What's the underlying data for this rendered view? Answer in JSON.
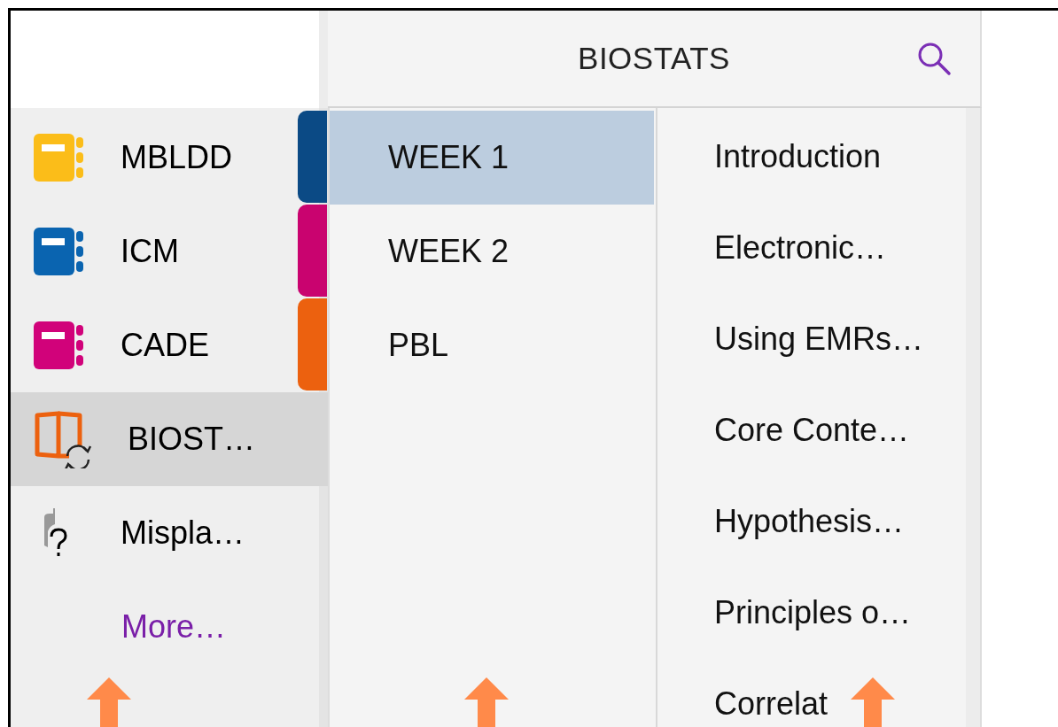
{
  "header": {
    "title": "BIOSTATS"
  },
  "notebooks": [
    {
      "kind": "notebook",
      "label": "MBLDD",
      "color": "#fbbd19",
      "selected": false
    },
    {
      "kind": "notebook",
      "label": "ICM",
      "color": "#0a64b0",
      "selected": false
    },
    {
      "kind": "notebook",
      "label": "CADE",
      "color": "#d1027a",
      "selected": false
    },
    {
      "kind": "syncing",
      "label": "BIOST…",
      "selected": true
    },
    {
      "kind": "misplaced",
      "label": "Mispla…",
      "selected": false
    }
  ],
  "more_link": "More…",
  "sections": [
    {
      "label": "WEEK 1",
      "color": "#0b4a85",
      "selected": true
    },
    {
      "label": "WEEK 2",
      "color": "#c9036f",
      "selected": false
    },
    {
      "label": "PBL",
      "color": "#ec610f",
      "selected": false
    }
  ],
  "pages": [
    "Introduction",
    "Electronic…",
    "Using EMRs…",
    "Core Conte…",
    "Hypothesis…",
    "Principles o…",
    "Correlat"
  ]
}
